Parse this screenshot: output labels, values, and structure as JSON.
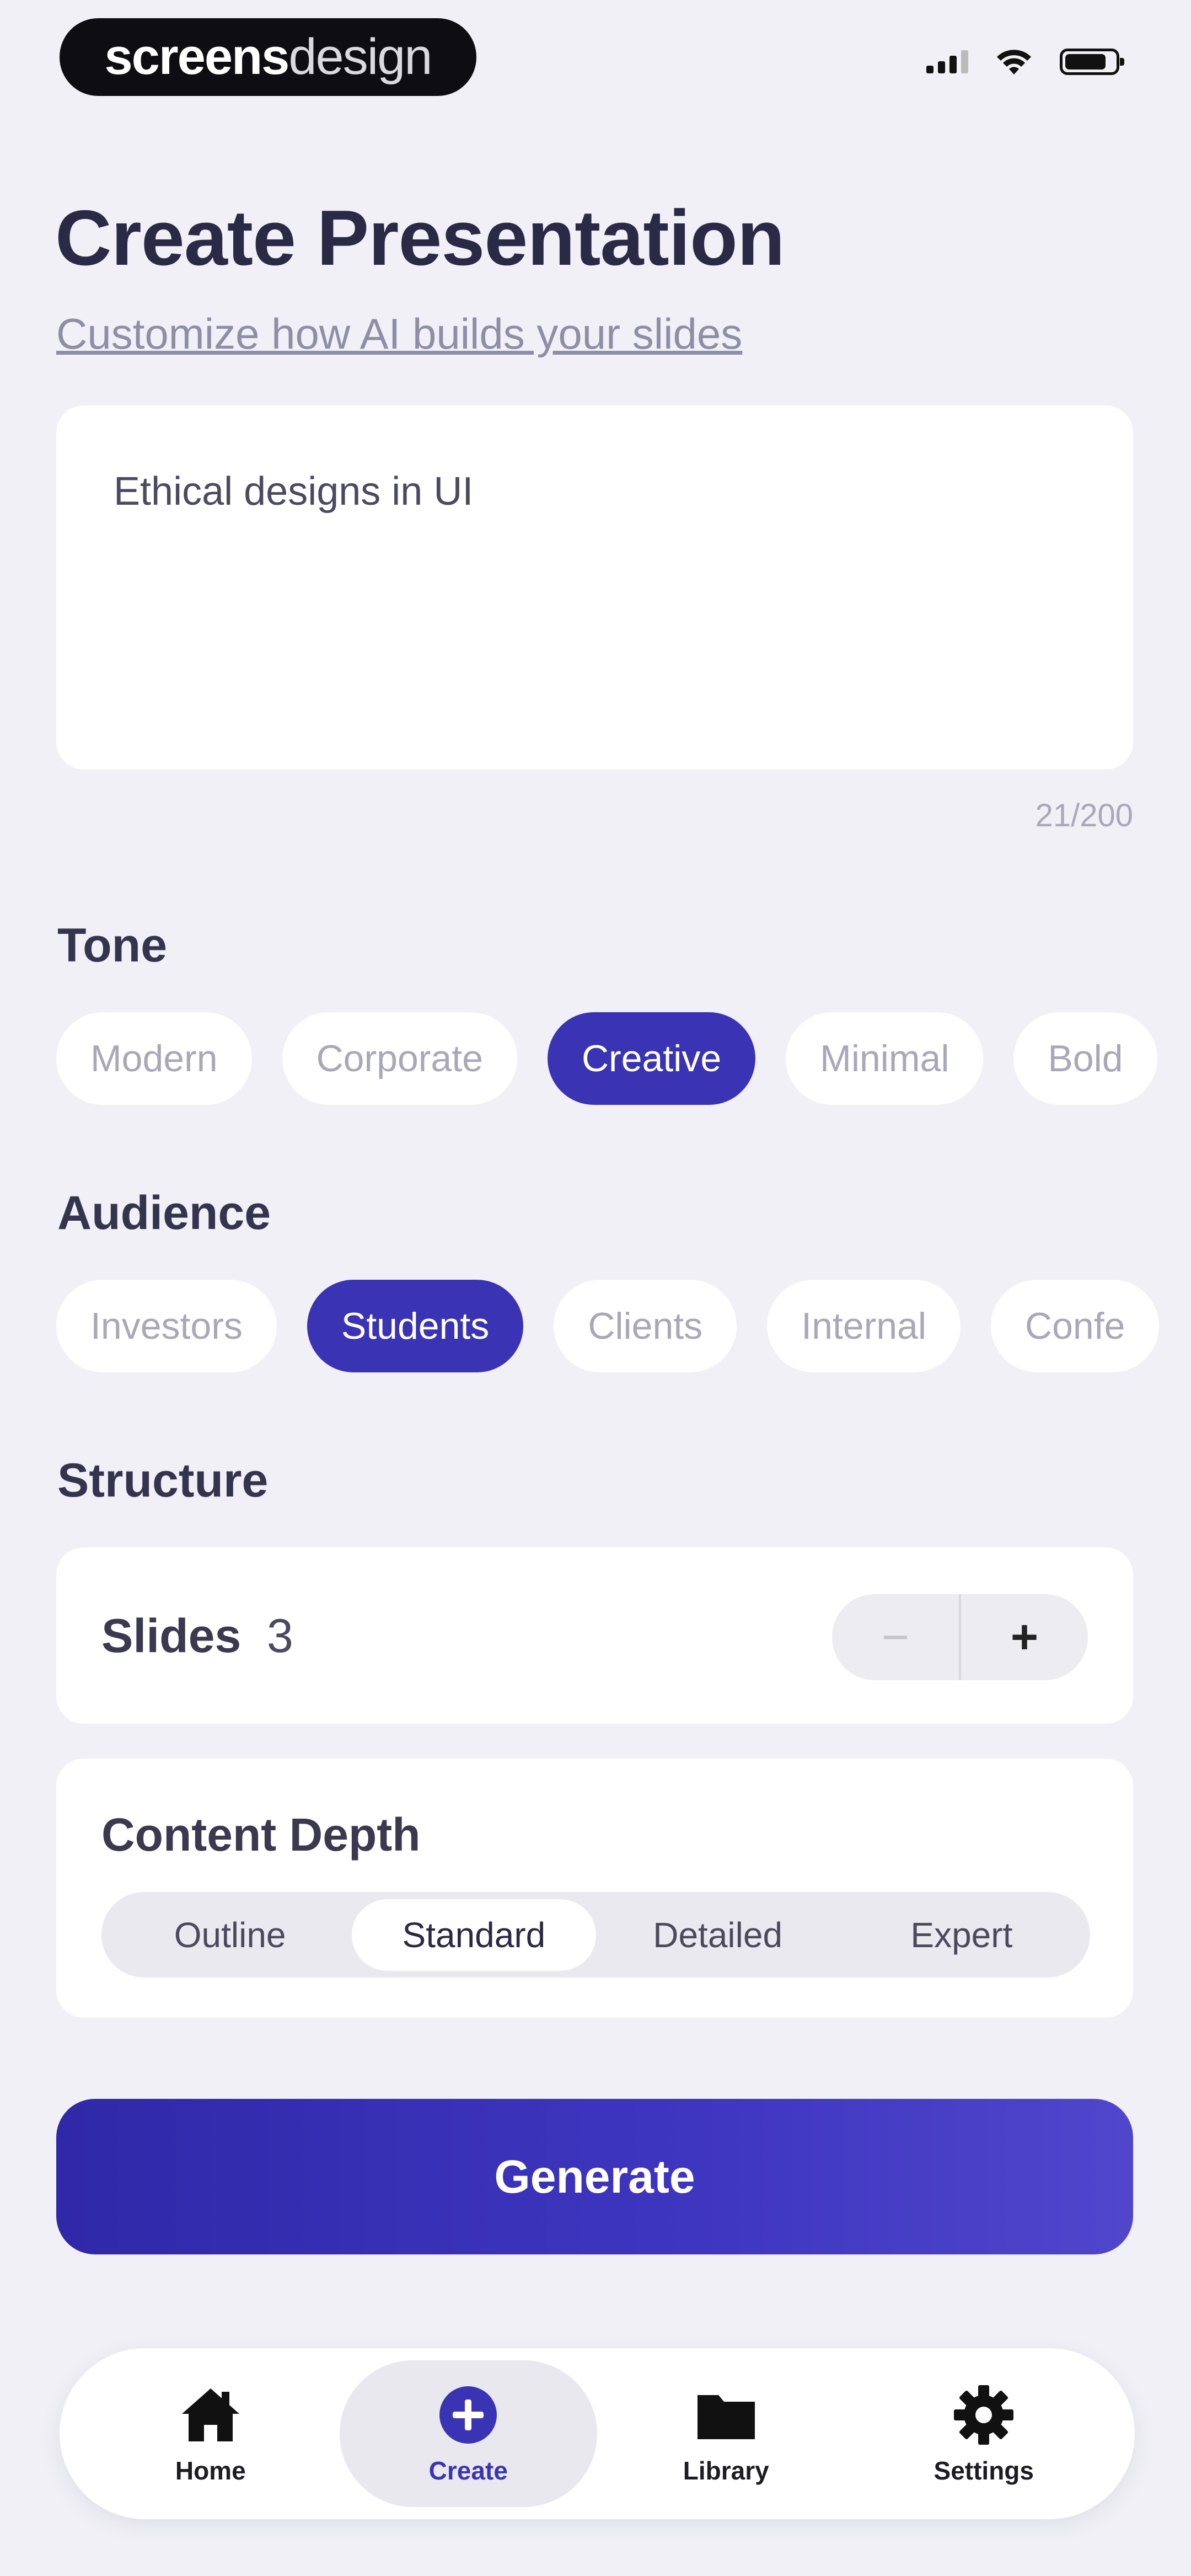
{
  "watermark": {
    "bold": "screens",
    "thin": "design"
  },
  "page": {
    "title": "Create Presentation",
    "subtitle": "Customize how AI builds your slides"
  },
  "prompt": {
    "value": "Ethical designs in UI",
    "counter": "21/200"
  },
  "tone": {
    "label": "Tone",
    "options": [
      "Modern",
      "Corporate",
      "Creative",
      "Minimal",
      "Bold"
    ],
    "selected": "Creative"
  },
  "audience": {
    "label": "Audience",
    "options": [
      "Investors",
      "Students",
      "Clients",
      "Internal",
      "Confe"
    ],
    "selected": "Students"
  },
  "structure": {
    "label": "Structure",
    "slides_label": "Slides",
    "slides_count": "3",
    "minus": "−",
    "plus": "+"
  },
  "depth": {
    "label": "Content Depth",
    "options": [
      "Outline",
      "Standard",
      "Detailed",
      "Expert"
    ],
    "selected": "Standard"
  },
  "generate_label": "Generate",
  "tabs": [
    {
      "label": "Home",
      "icon": "home-icon"
    },
    {
      "label": "Create",
      "icon": "plus-circle-icon"
    },
    {
      "label": "Library",
      "icon": "folder-icon"
    },
    {
      "label": "Settings",
      "icon": "gear-icon"
    }
  ],
  "active_tab": "Create",
  "colors": {
    "accent": "#3a34b4",
    "background": "#f0f0f6"
  }
}
